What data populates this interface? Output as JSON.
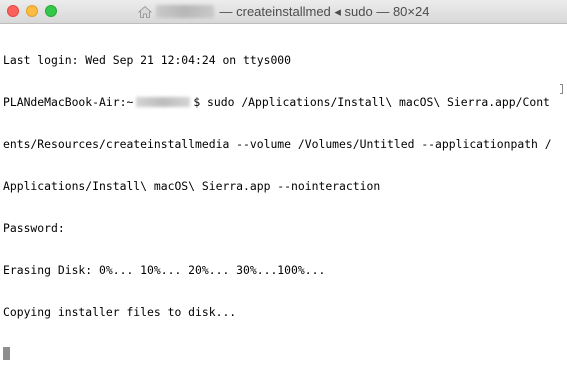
{
  "window": {
    "title_suffix": "— createinstallmed ◂ sudo — 80×24",
    "icon": "home-folder-icon"
  },
  "terminal": {
    "lines": [
      "Last login: Wed Sep 21 12:04:24 on ttys000",
      "PLANdeMacBook-Air:~",
      "$ sudo /Applications/Install\\ macOS\\ Sierra.app/Cont",
      "ents/Resources/createinstallmedia --volume /Volumes/Untitled --applicationpath /",
      "Applications/Install\\ macOS\\ Sierra.app --nointeraction",
      "Password:",
      "Erasing Disk: 0%... 10%... 20%... 30%...100%...",
      "Copying installer files to disk..."
    ]
  },
  "colors": {
    "close": "#fc605b",
    "minimize": "#fdbc40",
    "maximize": "#34c84a"
  }
}
